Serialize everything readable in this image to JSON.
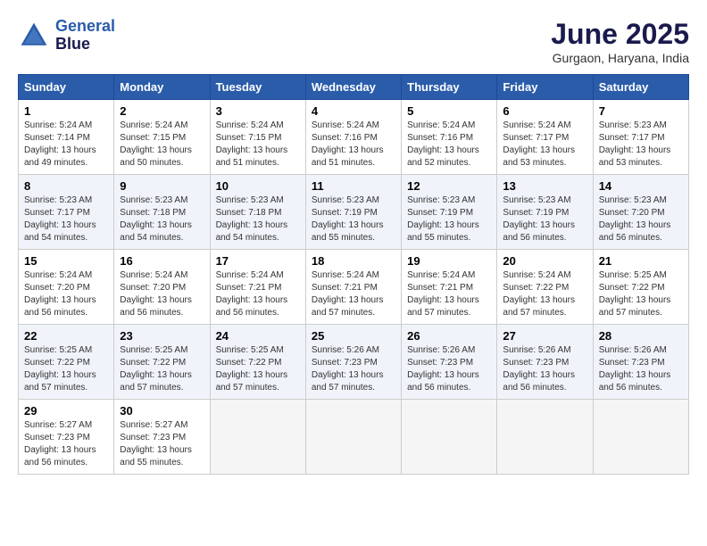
{
  "header": {
    "logo_line1": "General",
    "logo_line2": "Blue",
    "month": "June 2025",
    "location": "Gurgaon, Haryana, India"
  },
  "weekdays": [
    "Sunday",
    "Monday",
    "Tuesday",
    "Wednesday",
    "Thursday",
    "Friday",
    "Saturday"
  ],
  "weeks": [
    [
      {
        "day": "1",
        "info": "Sunrise: 5:24 AM\nSunset: 7:14 PM\nDaylight: 13 hours\nand 49 minutes."
      },
      {
        "day": "2",
        "info": "Sunrise: 5:24 AM\nSunset: 7:15 PM\nDaylight: 13 hours\nand 50 minutes."
      },
      {
        "day": "3",
        "info": "Sunrise: 5:24 AM\nSunset: 7:15 PM\nDaylight: 13 hours\nand 51 minutes."
      },
      {
        "day": "4",
        "info": "Sunrise: 5:24 AM\nSunset: 7:16 PM\nDaylight: 13 hours\nand 51 minutes."
      },
      {
        "day": "5",
        "info": "Sunrise: 5:24 AM\nSunset: 7:16 PM\nDaylight: 13 hours\nand 52 minutes."
      },
      {
        "day": "6",
        "info": "Sunrise: 5:24 AM\nSunset: 7:17 PM\nDaylight: 13 hours\nand 53 minutes."
      },
      {
        "day": "7",
        "info": "Sunrise: 5:23 AM\nSunset: 7:17 PM\nDaylight: 13 hours\nand 53 minutes."
      }
    ],
    [
      {
        "day": "8",
        "info": "Sunrise: 5:23 AM\nSunset: 7:17 PM\nDaylight: 13 hours\nand 54 minutes."
      },
      {
        "day": "9",
        "info": "Sunrise: 5:23 AM\nSunset: 7:18 PM\nDaylight: 13 hours\nand 54 minutes."
      },
      {
        "day": "10",
        "info": "Sunrise: 5:23 AM\nSunset: 7:18 PM\nDaylight: 13 hours\nand 54 minutes."
      },
      {
        "day": "11",
        "info": "Sunrise: 5:23 AM\nSunset: 7:19 PM\nDaylight: 13 hours\nand 55 minutes."
      },
      {
        "day": "12",
        "info": "Sunrise: 5:23 AM\nSunset: 7:19 PM\nDaylight: 13 hours\nand 55 minutes."
      },
      {
        "day": "13",
        "info": "Sunrise: 5:23 AM\nSunset: 7:19 PM\nDaylight: 13 hours\nand 56 minutes."
      },
      {
        "day": "14",
        "info": "Sunrise: 5:23 AM\nSunset: 7:20 PM\nDaylight: 13 hours\nand 56 minutes."
      }
    ],
    [
      {
        "day": "15",
        "info": "Sunrise: 5:24 AM\nSunset: 7:20 PM\nDaylight: 13 hours\nand 56 minutes."
      },
      {
        "day": "16",
        "info": "Sunrise: 5:24 AM\nSunset: 7:20 PM\nDaylight: 13 hours\nand 56 minutes."
      },
      {
        "day": "17",
        "info": "Sunrise: 5:24 AM\nSunset: 7:21 PM\nDaylight: 13 hours\nand 56 minutes."
      },
      {
        "day": "18",
        "info": "Sunrise: 5:24 AM\nSunset: 7:21 PM\nDaylight: 13 hours\nand 57 minutes."
      },
      {
        "day": "19",
        "info": "Sunrise: 5:24 AM\nSunset: 7:21 PM\nDaylight: 13 hours\nand 57 minutes."
      },
      {
        "day": "20",
        "info": "Sunrise: 5:24 AM\nSunset: 7:22 PM\nDaylight: 13 hours\nand 57 minutes."
      },
      {
        "day": "21",
        "info": "Sunrise: 5:25 AM\nSunset: 7:22 PM\nDaylight: 13 hours\nand 57 minutes."
      }
    ],
    [
      {
        "day": "22",
        "info": "Sunrise: 5:25 AM\nSunset: 7:22 PM\nDaylight: 13 hours\nand 57 minutes."
      },
      {
        "day": "23",
        "info": "Sunrise: 5:25 AM\nSunset: 7:22 PM\nDaylight: 13 hours\nand 57 minutes."
      },
      {
        "day": "24",
        "info": "Sunrise: 5:25 AM\nSunset: 7:22 PM\nDaylight: 13 hours\nand 57 minutes."
      },
      {
        "day": "25",
        "info": "Sunrise: 5:26 AM\nSunset: 7:23 PM\nDaylight: 13 hours\nand 57 minutes."
      },
      {
        "day": "26",
        "info": "Sunrise: 5:26 AM\nSunset: 7:23 PM\nDaylight: 13 hours\nand 56 minutes."
      },
      {
        "day": "27",
        "info": "Sunrise: 5:26 AM\nSunset: 7:23 PM\nDaylight: 13 hours\nand 56 minutes."
      },
      {
        "day": "28",
        "info": "Sunrise: 5:26 AM\nSunset: 7:23 PM\nDaylight: 13 hours\nand 56 minutes."
      }
    ],
    [
      {
        "day": "29",
        "info": "Sunrise: 5:27 AM\nSunset: 7:23 PM\nDaylight: 13 hours\nand 56 minutes."
      },
      {
        "day": "30",
        "info": "Sunrise: 5:27 AM\nSunset: 7:23 PM\nDaylight: 13 hours\nand 55 minutes."
      },
      {
        "day": "",
        "info": ""
      },
      {
        "day": "",
        "info": ""
      },
      {
        "day": "",
        "info": ""
      },
      {
        "day": "",
        "info": ""
      },
      {
        "day": "",
        "info": ""
      }
    ]
  ]
}
